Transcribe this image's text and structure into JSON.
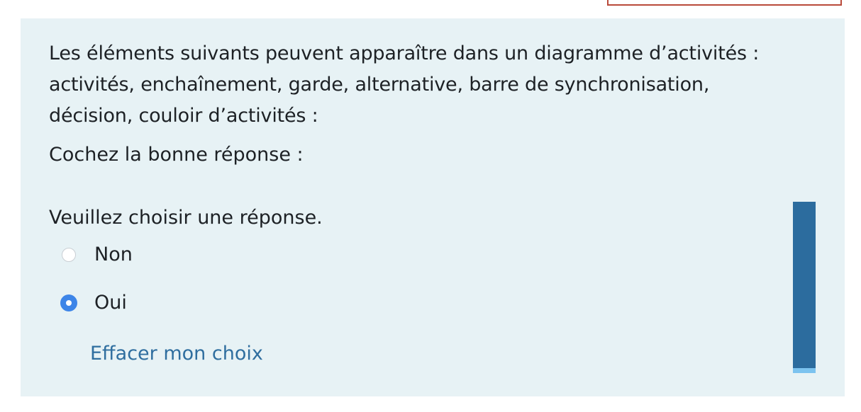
{
  "question": {
    "text": "Les éléments suivants peuvent apparaître dans un diagramme d’activités : activités, enchaînement, garde, alternative, barre de synchronisation, décision, couloir d’activités :",
    "prompt": "Cochez la bonne réponse :",
    "instruction": "Veuillez choisir une réponse."
  },
  "options": [
    {
      "label": "Non",
      "checked": false
    },
    {
      "label": "Oui",
      "checked": true
    }
  ],
  "clear_choice_label": "Effacer mon choix",
  "colors": {
    "card_background": "#e7f2f5",
    "link": "#2f6e9f",
    "radio_checked": "#3d85e8",
    "side_bar": "#2c6c9e",
    "top_box_border": "#b94a3a"
  }
}
